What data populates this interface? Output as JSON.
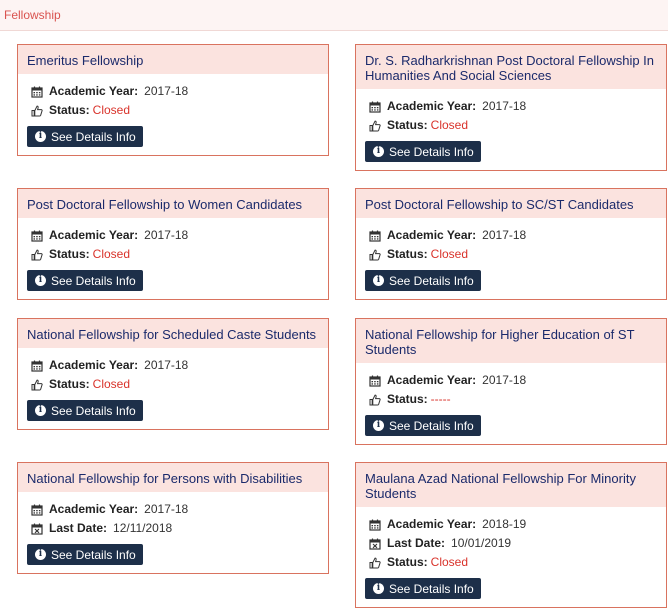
{
  "header": {
    "title": "Fellowship"
  },
  "labels": {
    "academic_year": "Academic Year:",
    "status": "Status:",
    "last_date": "Last Date:",
    "details_button": "See Details Info"
  },
  "colors": {
    "card_border": "#d9735f",
    "card_head_bg": "#fbe3df",
    "title": "#1b2a6b",
    "closed": "#d9332b",
    "button": "#1d2f49"
  },
  "cards": [
    {
      "title": "Emeritus Fellowship",
      "academic_year": "2017-18",
      "status": "Closed"
    },
    {
      "title": "Dr. S. Radharkrishnan Post Doctoral Fellowship In Humanities And Social Sciences",
      "academic_year": "2017-18",
      "status": "Closed"
    },
    {
      "title": "Post Doctoral Fellowship to Women Candidates",
      "academic_year": "2017-18",
      "status": "Closed"
    },
    {
      "title": "Post Doctoral Fellowship to SC/ST Candidates",
      "academic_year": "2017-18",
      "status": "Closed"
    },
    {
      "title": "National Fellowship for Scheduled Caste Students",
      "academic_year": "2017-18",
      "status": "Closed"
    },
    {
      "title": "National Fellowship for Higher Education of ST Students",
      "academic_year": "2017-18",
      "status": "-----"
    },
    {
      "title": "National Fellowship for Persons with Disabilities",
      "academic_year": "2017-18",
      "last_date": "12/11/2018"
    },
    {
      "title": "Maulana Azad National Fellowship For Minority Students",
      "academic_year": "2018-19",
      "last_date": "10/01/2019",
      "status": "Closed"
    }
  ]
}
